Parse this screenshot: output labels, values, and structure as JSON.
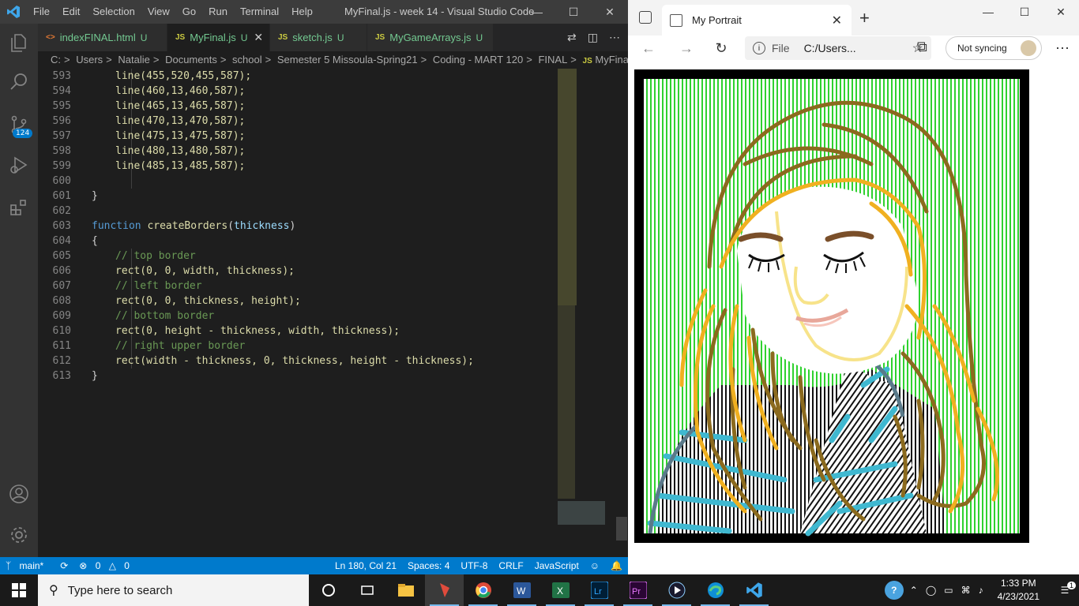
{
  "vscode": {
    "menu": [
      "File",
      "Edit",
      "Selection",
      "View",
      "Go",
      "Run",
      "Terminal",
      "Help"
    ],
    "window_title": "MyFinal.js - week 14 - Visual Studio Code",
    "activity_badge": "124",
    "tabs": [
      {
        "icon": "<>",
        "label": "indexFINAL.html",
        "status": "U"
      },
      {
        "icon": "JS",
        "label": "MyFinal.js",
        "status": "U"
      },
      {
        "icon": "JS",
        "label": "sketch.js",
        "status": "U"
      },
      {
        "icon": "JS",
        "label": "MyGameArrays.js",
        "status": "U"
      }
    ],
    "breadcrumb": [
      "C:",
      "Users",
      "Natalie",
      "Documents",
      "school",
      "Semester 5 Missoula-Spring21",
      "Coding - MART 120",
      "FINAL",
      "MyFinal.js"
    ],
    "breadcrumb_file_icon": "JS",
    "line_numbers": [
      "593",
      "594",
      "595",
      "596",
      "597",
      "598",
      "599",
      "600",
      "601",
      "602",
      "603",
      "604",
      "605",
      "606",
      "607",
      "608",
      "609",
      "610",
      "611",
      "612",
      "613"
    ],
    "code": {
      "l593": "line(455,520,455,587);",
      "l594": "line(460,13,460,587);",
      "l595": "line(465,13,465,587);",
      "l596": "line(470,13,470,587);",
      "l597": "line(475,13,475,587);",
      "l598": "line(480,13,480,587);",
      "l599": "line(485,13,485,587);",
      "l601": "}",
      "l603_kw": "function",
      "l603_fn": "createBorders",
      "l603_param": "thickness",
      "l604": "{",
      "c605": "// top border",
      "c607": "// left border",
      "c609": "// bottom border",
      "c611": "// right upper border",
      "r606": "rect(0, 0, width, thickness);",
      "r608": "rect(0, 0, thickness, height);",
      "r610": "rect(0, height - thickness, width, thickness);",
      "r612": "rect(width - thickness, 0, thickness, height - thickness);",
      "l613": "}"
    },
    "status": {
      "branch": "main*",
      "errors": "0",
      "warnings": "0",
      "position": "Ln 180, Col 21",
      "spaces": "Spaces: 4",
      "encoding": "UTF-8",
      "eol": "CRLF",
      "language": "JavaScript"
    }
  },
  "browser": {
    "tab_title": "My Portrait",
    "address_scheme": "File",
    "address_path": "C:/Users...",
    "sync_label": "Not syncing"
  },
  "taskbar": {
    "search_placeholder": "Type here to search",
    "time": "1:33 PM",
    "date": "4/23/2021",
    "notification_count": "1"
  },
  "colors": {
    "accent": "#007acc",
    "portrait_green": "#2fd12f",
    "hair_gold": "#f0b020",
    "hair_brown": "#8b6a1e",
    "shirt_blue": "#3fb8d0"
  }
}
